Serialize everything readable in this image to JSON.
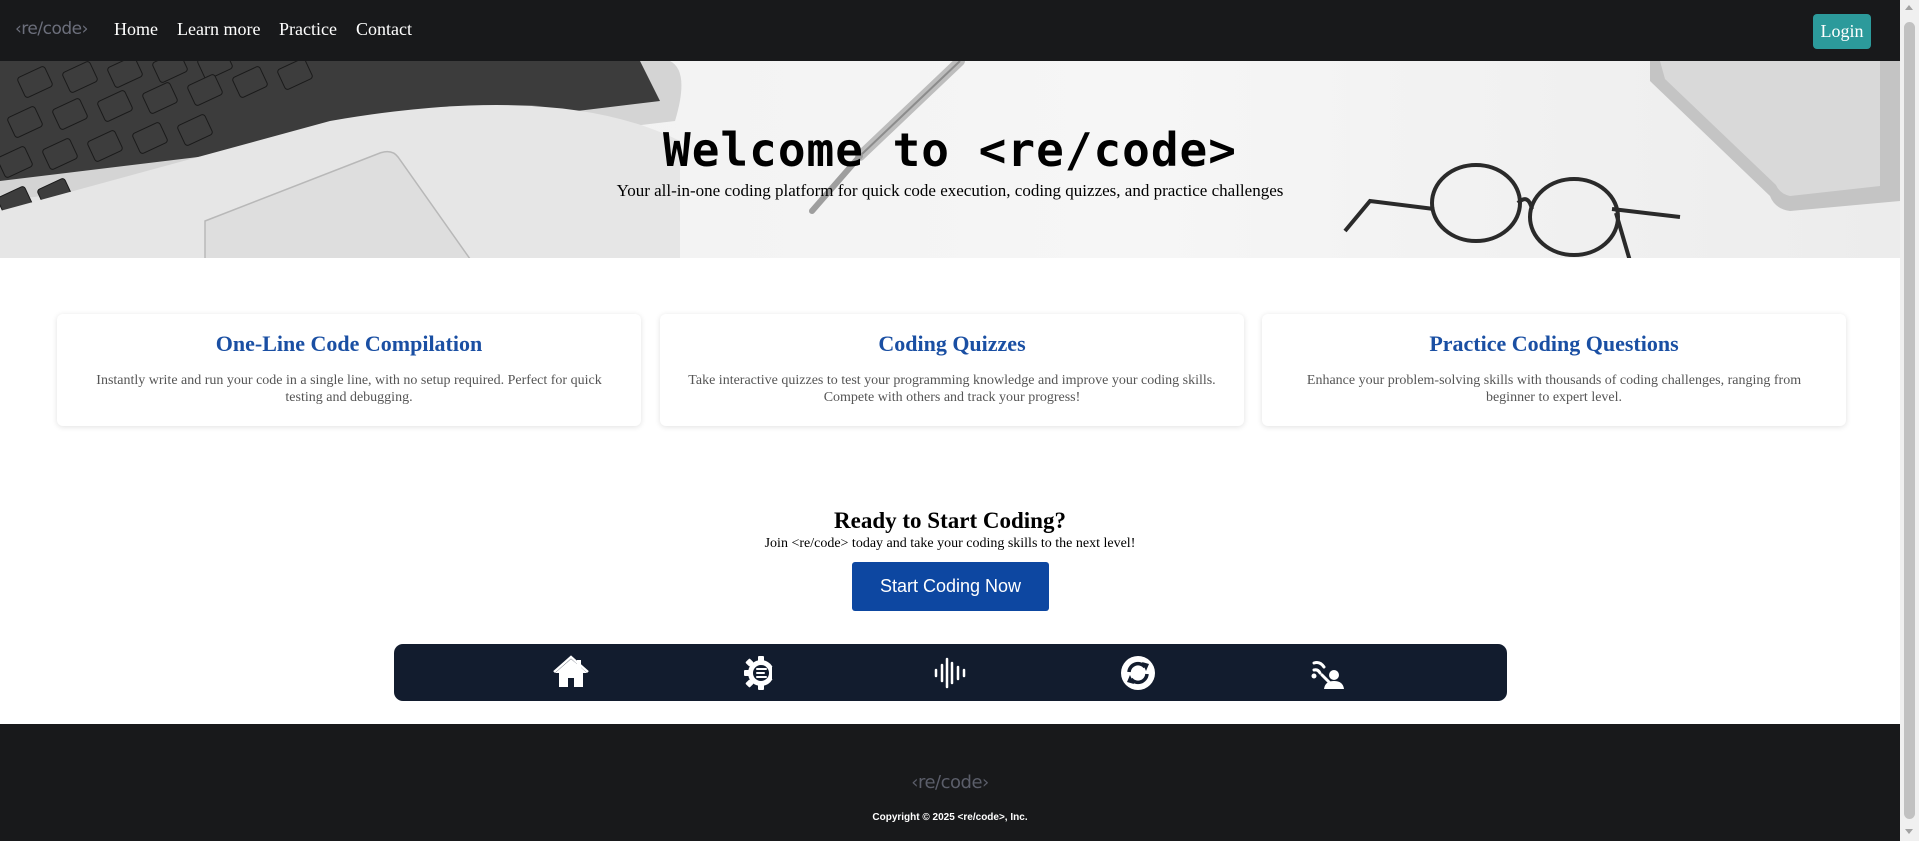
{
  "navbar": {
    "brand": "‹re/code›",
    "links": [
      "Home",
      "Learn more",
      "Practice",
      "Contact"
    ],
    "login_label": "Login",
    "login_color": "#2c9a9b"
  },
  "hero": {
    "title": "Welcome to <re/code>",
    "subtitle": "Your all-in-one coding platform for quick code execution, coding quizzes, and practice challenges"
  },
  "features": [
    {
      "title": "One-Line Code Compilation",
      "description": "Instantly write and run your code in a single line, with no setup required. Perfect for quick testing and debugging."
    },
    {
      "title": "Coding Quizzes",
      "description": "Take interactive quizzes to test your programming knowledge and improve your coding skills. Compete with others and track your progress!"
    },
    {
      "title": "Practice Coding Questions",
      "description": "Enhance your problem-solving skills with thousands of coding challenges, ranging from beginner to expert level."
    }
  ],
  "cta": {
    "title": "Ready to Start Coding?",
    "subtitle": "Join <re/code> today and take your coding skills to the next level!",
    "button_label": "Start Coding Now",
    "button_color": "#0d47a1"
  },
  "icon_bar": {
    "icons": [
      "home-icon",
      "code-gear-icon",
      "audio-wave-icon",
      "sync-icon",
      "signal-person-icon"
    ]
  },
  "footer": {
    "brand": "‹re/code›",
    "copyright": "Copyright © 2025 <re/code>, Inc."
  },
  "colors": {
    "nav_bg": "#18191b",
    "accent_blue": "#1a4fa3",
    "icon_bar_bg": "#121c2e"
  }
}
